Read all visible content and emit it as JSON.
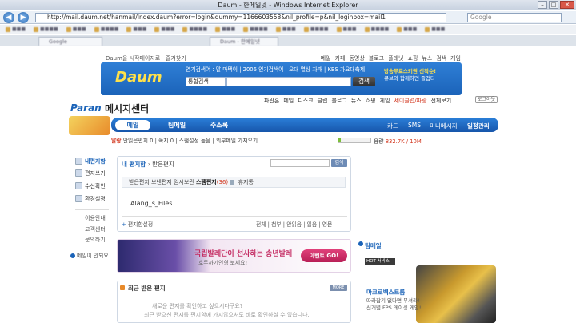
{
  "window": {
    "title": "Daum - 한메일넷 - Windows Internet Explorer",
    "url": "http://mail.daum.net/hanmail/Index.daum?error=login&dummy=1166603558&nil_profile=p&nil_loginbox=mail1",
    "search_placeholder": "Google",
    "tabs": [
      "Google",
      "Daum - 한메일넷"
    ]
  },
  "daum": {
    "toplink_left": "Daum을 시작페이지로 · 즐겨찾기",
    "toplinks_right": [
      "메일",
      "카페",
      "동영상",
      "블로그",
      "플래닛",
      "쇼핑",
      "뉴스",
      "검색",
      "게임"
    ],
    "logo": "Daum",
    "banner_links": "연기검색어 : 말 마택이 | 2006 연기검색어 | 오대 열상 자때 | KBS 가요대축제",
    "search_select": "통합검색",
    "search_button": "검색",
    "ad_line1": "방송무료스키권 선착순!",
    "ad_line2": "큐브와 함께하면 즐겁다"
  },
  "paran": {
    "logo": "Paran",
    "title": "메시지센터",
    "links": [
      "파란홈",
      "메일",
      "디스크",
      "클럽",
      "블로그",
      "뉴스",
      "쇼핑",
      "게임"
    ],
    "links_highlight": "세이클럽/파랑",
    "all_services": "전체보기",
    "logout": "로그아웃",
    "nav_tabs": [
      "메일",
      "팀메일",
      "주소록"
    ],
    "nav_right": [
      "카드",
      "SMS",
      "미니메시지",
      "일정관리"
    ]
  },
  "status": {
    "user": "알랑",
    "items": "안읽은편지 0 | 쪽지 0 | 스팸설정 높음 | 외부메일 가져오기",
    "usage_label": "용량",
    "usage_value": "832.7K / 10M",
    "usage_fraction": 0.08
  },
  "sidebar": {
    "items": [
      "내편지함",
      "편지쓰기",
      "수신확인",
      "환경설정"
    ],
    "sub_items": [
      "이용안내",
      "고객센터",
      "문의하기"
    ],
    "help": "메일이 안되요"
  },
  "mailbox": {
    "title": "내 편지함",
    "subtitle": "받은편지",
    "search_button": "검색",
    "folders_pre": "받은편지   보낸편지   임시보관",
    "folder_spam": "스팸편지",
    "folder_spam_count": "(36)",
    "folder_trash": "휴지통",
    "folder_name": "Alang_s_Files",
    "footer_left": "편지함설정",
    "footer_right": "전체 | 첨부 | 안읽음 | 읽음 | 영문"
  },
  "ballet": {
    "title": "국립발레단이 선사하는 송년발레",
    "subtitle": "호두까기인형 보세요!",
    "button": "이벤트 GO!"
  },
  "recent": {
    "title": "최근 받은 편지",
    "more": "MORE",
    "empty1": "새로운 편지를 확인하고 싶으시다구요?",
    "empty2": "최근 받으신 편지를 편지함에 가지않으셔도 바로 확인하실 수 있습니다."
  },
  "right": {
    "label": "팀메일",
    "hot": "HOT 서비스",
    "hot_title": "마크로벡스트롬",
    "hot_desc1": "따라잡기 없다면 부셔라!",
    "hot_desc2": "신개념 FPS 레이싱 게임!"
  },
  "colors": {
    "accent": "#1a63b8",
    "nav": "#1756ab",
    "alert": "#d2361e"
  }
}
